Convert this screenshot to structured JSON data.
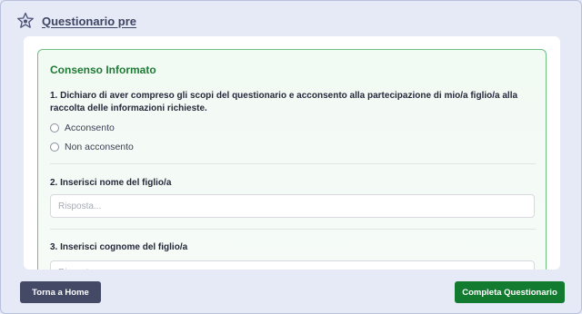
{
  "header": {
    "title": "Questionario pre",
    "icon": "star-icon"
  },
  "section": {
    "title": "Consenso Informato",
    "accent_color": "#1f7a35",
    "border_color": "#6fbf84"
  },
  "questions": [
    {
      "label": "1. Dichiaro di aver compreso gli scopi del questionario e acconsento alla partecipazione di mio/a figlio/a alla raccolta delle informazioni richieste.",
      "type": "radio",
      "options": [
        "Acconsento",
        "Non acconsento"
      ]
    },
    {
      "label": "2. Inserisci nome del figlio/a",
      "type": "text",
      "placeholder": "Risposta...",
      "value": ""
    },
    {
      "label": "3. Inserisci cognome del figlio/a",
      "type": "text",
      "placeholder": "Risposta...",
      "value": ""
    }
  ],
  "footer": {
    "home_label": "Torna a Home",
    "complete_label": "Completa Questionario",
    "home_color": "#444965",
    "complete_color": "#137b30"
  }
}
